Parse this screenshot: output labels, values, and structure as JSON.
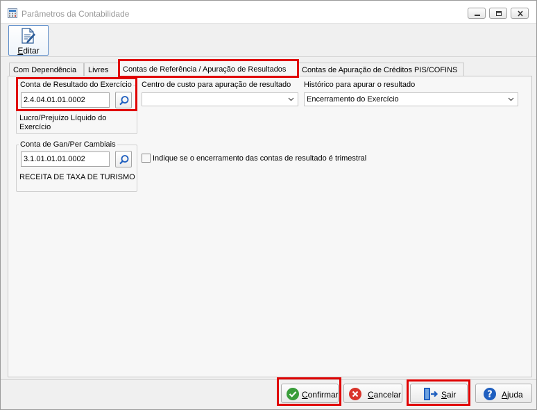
{
  "window": {
    "title": "Parâmetros da Contabilidade"
  },
  "toolbar": {
    "editar_prefix": "",
    "editar_access": "E",
    "editar_rest": "ditar"
  },
  "tabs": [
    {
      "label": "Com Dependência"
    },
    {
      "label": "Livres"
    },
    {
      "label": "Contas de Referência / Apuração de Resultados"
    },
    {
      "label": "Contas de Apuração de Créditos PIS/COFINS"
    }
  ],
  "resultado": {
    "group_title": "Conta de Resultado do Exercício",
    "value": "2.4.04.01.01.0002",
    "description": "Lucro/Prejuízo Líquido do Exercício"
  },
  "ganper": {
    "group_title": "Conta de Gan/Per Cambiais",
    "value": "3.1.01.01.01.0002",
    "description": "RECEITA DE TAXA DE TURISMO"
  },
  "centro_custo": {
    "label": "Centro de custo para apuração de resultado",
    "value": ""
  },
  "historico": {
    "label": "Histórico para apurar o resultado",
    "value": "Encerramento do Exercício"
  },
  "trimestral": {
    "label": "Indique se o encerramento das contas de resultado é trimestral",
    "checked": false
  },
  "buttons": {
    "confirmar": {
      "access": "C",
      "rest": "onfirmar"
    },
    "cancelar": {
      "access": "C",
      "rest": "ancelar"
    },
    "sair": {
      "access": "S",
      "rest": "air"
    },
    "ajuda": {
      "access": "A",
      "rest": "juda"
    }
  },
  "colors": {
    "highlight": "#e00000",
    "confirm_green": "#3a9d3a",
    "cancel_red": "#d9342b",
    "help_blue": "#1f5fbf"
  }
}
